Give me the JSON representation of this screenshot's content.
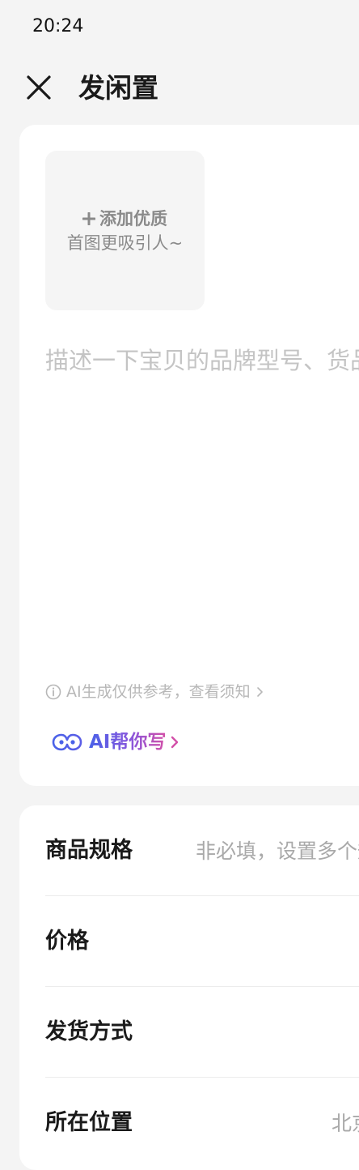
{
  "status_bar": {
    "time": "20:24"
  },
  "header": {
    "title": "发闲置",
    "close_icon": "close-icon"
  },
  "photo_upload": {
    "line1": "添加优质",
    "line2": "首图更吸引人~",
    "icon": "plus-icon"
  },
  "description": {
    "placeholder": "描述一下宝贝的品牌型号、货品来源…",
    "value": ""
  },
  "ai_notice": {
    "text": "AI生成仅供参考，查看须知",
    "icon": "info-icon"
  },
  "ai_write": {
    "label": "AI帮你写",
    "icon": "ai-logo-icon",
    "gradient": [
      "#4a62e8",
      "#8a56dc",
      "#d34fa8"
    ]
  },
  "form_rows": [
    {
      "label": "商品规格",
      "value": "非必填，设置多个规格"
    },
    {
      "label": "价格",
      "value": ""
    },
    {
      "label": "发货方式",
      "value": ""
    },
    {
      "label": "所在位置",
      "value": "北京"
    }
  ],
  "colors": {
    "background": "#f4f4f4",
    "card": "#ffffff",
    "placeholder": "#c4c4c4"
  }
}
